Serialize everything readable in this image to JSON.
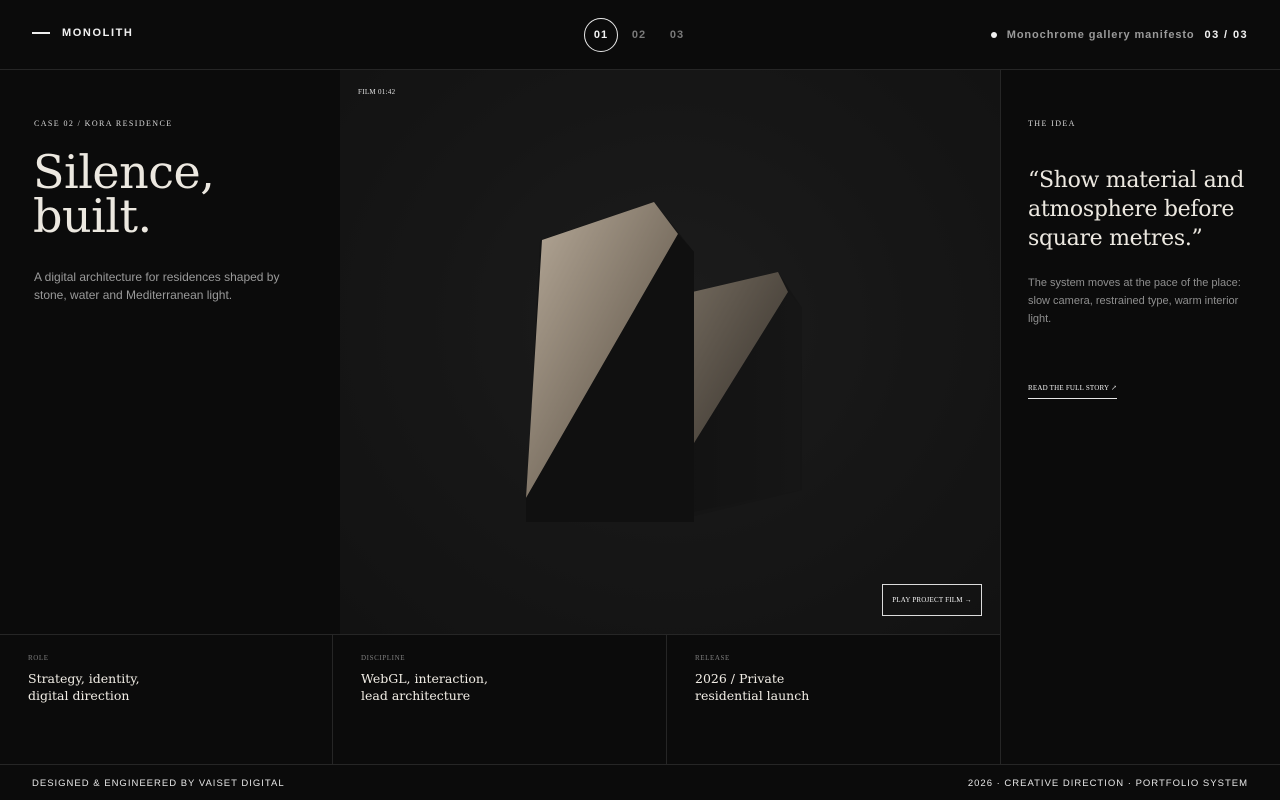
{
  "header": {
    "brand": "MONOLITH",
    "pages": [
      "01",
      "02",
      "03"
    ],
    "active_page": "01",
    "status_text": "Monochrome gallery manifesto",
    "status_count": "03 / 03"
  },
  "left": {
    "eyebrow": "CASE 02 / KORA RESIDENCE",
    "title_lines": [
      "Silence,",
      "built."
    ],
    "description": "A digital architecture for residences shaped by stone, water and Mediterranean light."
  },
  "stage": {
    "film_tag": "FILM 01:42",
    "play_label": "PLAY PROJECT FILM →"
  },
  "idea": {
    "eyebrow": "THE IDEA",
    "quote": "“Show material and atmosphere before square metres.”",
    "description": "The system moves at the pace of the place: slow camera, restrained type, warm interior light.",
    "link_label": "READ THE FULL STORY ↗"
  },
  "meta": [
    {
      "label": "ROLE",
      "value": "Strategy, identity, digital direction"
    },
    {
      "label": "DISCIPLINE",
      "value": "WebGL, interaction, lead architecture"
    },
    {
      "label": "RELEASE",
      "value": "2026 / Private residential launch"
    }
  ],
  "footer": {
    "left": "DESIGNED & ENGINEERED BY VAISET DIGITAL",
    "right": "2026 · CREATIVE DIRECTION · PORTFOLIO SYSTEM"
  },
  "colors": {
    "background": "#0b0b0b",
    "stage": "#161616",
    "stone_light": "#b5a897",
    "text": "#ece8e0"
  }
}
